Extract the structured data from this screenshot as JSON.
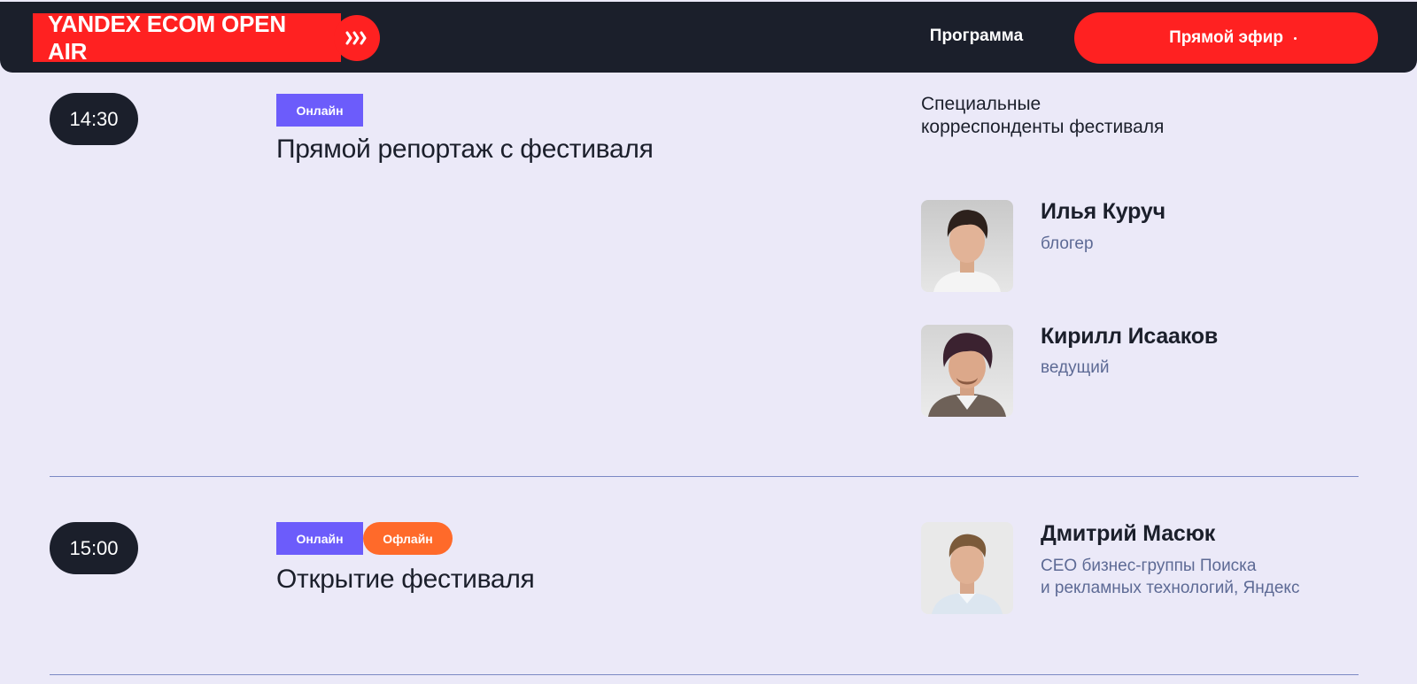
{
  "header": {
    "logo_text": "YANDEX ECOM OPEN AIR",
    "logo_icon": "triple-chevron-icon",
    "nav_program": "Программа",
    "live_button": "Прямой эфир"
  },
  "colors": {
    "brand_red": "#ff2121",
    "header_bg": "#1b1f2b",
    "page_bg": "#ebe9f8",
    "online_tag": "#6c5cfb",
    "offline_tag": "#ff6a2a",
    "role_text": "#5d6a95"
  },
  "sessions": [
    {
      "time": "14:30",
      "tags": [
        "Онлайн"
      ],
      "title": "Прямой репортаж с фестиваля",
      "speakers_heading": "Специальные корреспонденты фестиваля",
      "speakers": [
        {
          "name": "Илья Куруч",
          "role": "блогер"
        },
        {
          "name": "Кирилл Исааков",
          "role": "ведущий"
        }
      ]
    },
    {
      "time": "15:00",
      "tags": [
        "Онлайн",
        "Офлайн"
      ],
      "title": "Открытие фестиваля",
      "speakers": [
        {
          "name": "Дмитрий Масюк",
          "role_line1": "CEO бизнес-группы Поиска",
          "role_line2": "и рекламных технологий, Яндекс"
        }
      ]
    }
  ]
}
